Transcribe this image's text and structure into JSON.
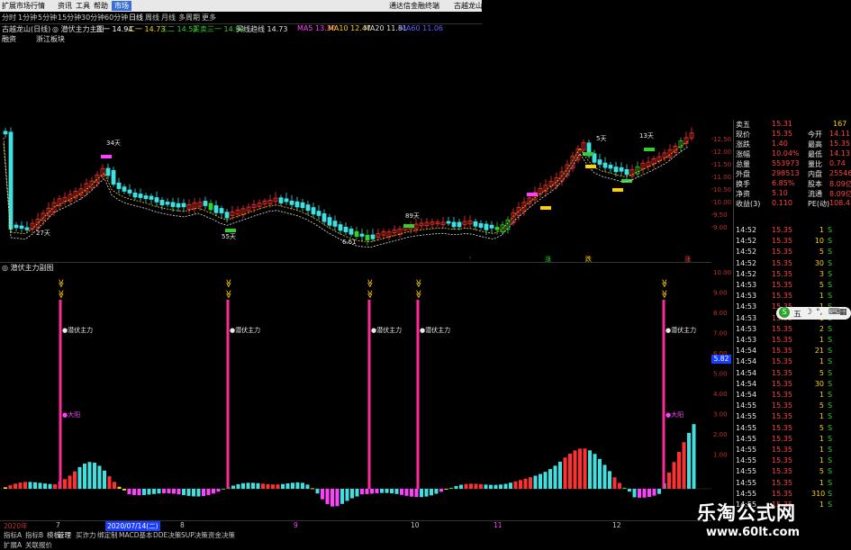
{
  "menubar": {
    "items": [
      "扩展市场行情",
      "资讯",
      "工具",
      "帮助",
      "市场"
    ],
    "right": [
      "通达信金融终端",
      "古越龙山"
    ]
  },
  "periods": [
    "分时",
    "1分钟",
    "5分钟",
    "15分钟",
    "30分钟",
    "60分钟",
    "日线",
    "周线",
    "月线",
    "多周期",
    "更多"
  ],
  "infobar": {
    "stock": "古越龙山(日线)",
    "indicator": "◎ 潜伏主力主图",
    "p1": "三一 14.94",
    "p2": "二一 14.73",
    "p3": "三二 14.52",
    "p4": "买卖三一 14.94",
    "p5": "买线趋线 14.73",
    "ma5": "MA5 13.30",
    "ma10": "MA10 12.47",
    "ma20": "MA20 11.81",
    "ma60": "MA60 11.06"
  },
  "subbar": {
    "a": "融资",
    "b": "浙江板块"
  },
  "main_chart": {
    "annotations": [
      "34天",
      "27天",
      "55天",
      "89天",
      "5天",
      "13天",
      "6.61"
    ],
    "right_axis": [
      "12.50",
      "12.00",
      "11.50",
      "11.00",
      "10.50",
      "10.00",
      "9.50",
      "9.00"
    ]
  },
  "indicator_bar": {
    "title": "◎ 潜伏主力副图"
  },
  "sub_chart": {
    "label_main": "潜伏主力",
    "label_big": "大阳",
    "right_axis": [
      "10.00",
      "9.00",
      "8.00",
      "7.00",
      "6.00",
      "5.00",
      "4.00",
      "3.00",
      "2.00",
      "1.00"
    ],
    "cursor_value": "5.82",
    "signal_labels": [
      "涨",
      "跌",
      "涨"
    ]
  },
  "date_axis": {
    "year": "2020年",
    "ticks": [
      "7",
      "2020/07/14(二)",
      "8",
      "9",
      "10",
      "11",
      "12"
    ]
  },
  "bottom_tabs": [
    "指标A",
    "指标B",
    "模板",
    "管理",
    "买诈力",
    "绑定制",
    "MACD基本",
    "DDE决策",
    "SUP决策",
    "资金决策"
  ],
  "bottom_row2": [
    "扩展A",
    "关联报价"
  ],
  "quote": {
    "rows": [
      {
        "k": "卖五",
        "v": "15.31",
        "x": "167"
      },
      {
        "k": "现价",
        "v": "15.35",
        "k2": "今开",
        "v2": "14.11"
      },
      {
        "k": "涨跌",
        "v": "1.40",
        "k2": "最高",
        "v2": "15.35"
      },
      {
        "k": "涨幅",
        "v": "10.04%",
        "k2": "最低",
        "v2": "14.13"
      },
      {
        "k": "总量",
        "v": "553973",
        "k2": "量比",
        "v2": "0.74"
      },
      {
        "k": "外盘",
        "v": "298513",
        "k2": "内盘",
        "v2": "255460"
      },
      {
        "k": "换手",
        "v": "6.85%",
        "k2": "股本",
        "v2": "8.09亿"
      },
      {
        "k": "净资",
        "v": "5.10",
        "k2": "流通",
        "v2": "8.09亿"
      },
      {
        "k": "收益(3)",
        "v": "0.110",
        "k2": "PE(动)",
        "v2": "108.4"
      }
    ],
    "ticks": [
      {
        "t": "14:52",
        "p": "15.35",
        "v": "1",
        "s": "S"
      },
      {
        "t": "14:52",
        "p": "15.35",
        "v": "10",
        "s": "S"
      },
      {
        "t": "14:52",
        "p": "15.35",
        "v": "5",
        "s": "S"
      },
      {
        "t": "14:52",
        "p": "15.35",
        "v": "30",
        "s": "S"
      },
      {
        "t": "14:52",
        "p": "15.35",
        "v": "3",
        "s": "S"
      },
      {
        "t": "14:53",
        "p": "15.35",
        "v": "5",
        "s": "S"
      },
      {
        "t": "14:53",
        "p": "15.35",
        "v": "1",
        "s": "S"
      },
      {
        "t": "14:53",
        "p": "15.35",
        "v": "1",
        "s": "S"
      },
      {
        "t": "14:53",
        "p": "15.35",
        "v": "1",
        "s": "S"
      },
      {
        "t": "14:53",
        "p": "15.35",
        "v": "2",
        "s": "S"
      },
      {
        "t": "14:53",
        "p": "15.35",
        "v": "1",
        "s": "S"
      },
      {
        "t": "14:54",
        "p": "15.35",
        "v": "21",
        "s": "S"
      },
      {
        "t": "14:54",
        "p": "15.35",
        "v": "1",
        "s": "S"
      },
      {
        "t": "14:54",
        "p": "15.35",
        "v": "5",
        "s": "S"
      },
      {
        "t": "14:54",
        "p": "15.35",
        "v": "30",
        "s": "S"
      },
      {
        "t": "14:54",
        "p": "15.35",
        "v": "1",
        "s": "S"
      },
      {
        "t": "14:55",
        "p": "15.35",
        "v": "5",
        "s": "S"
      },
      {
        "t": "14:55",
        "p": "15.35",
        "v": "1",
        "s": "S"
      },
      {
        "t": "14:55",
        "p": "15.35",
        "v": "5",
        "s": "S"
      },
      {
        "t": "14:55",
        "p": "15.35",
        "v": "1",
        "s": "S"
      },
      {
        "t": "14:55",
        "p": "15.35",
        "v": "1",
        "s": "S"
      },
      {
        "t": "14:55",
        "p": "15.35",
        "v": "1",
        "s": "S"
      },
      {
        "t": "14:55",
        "p": "15.35",
        "v": "5",
        "s": "S"
      },
      {
        "t": "14:55",
        "p": "15.35",
        "v": "1",
        "s": "S"
      },
      {
        "t": "14:55",
        "p": "15.35",
        "v": "310",
        "s": "S"
      },
      {
        "t": "14:55",
        "p": "15.35",
        "v": "1",
        "s": "S"
      }
    ]
  },
  "kbd_widget": {
    "label": "五"
  },
  "watermark": {
    "cn": "乐淘公式网",
    "url": "www.60lt.com"
  },
  "colors": {
    "up": "#ff3030",
    "down": "#40e0e0",
    "signal": "#ff2a9a",
    "accent": "#3a6fd8"
  }
}
